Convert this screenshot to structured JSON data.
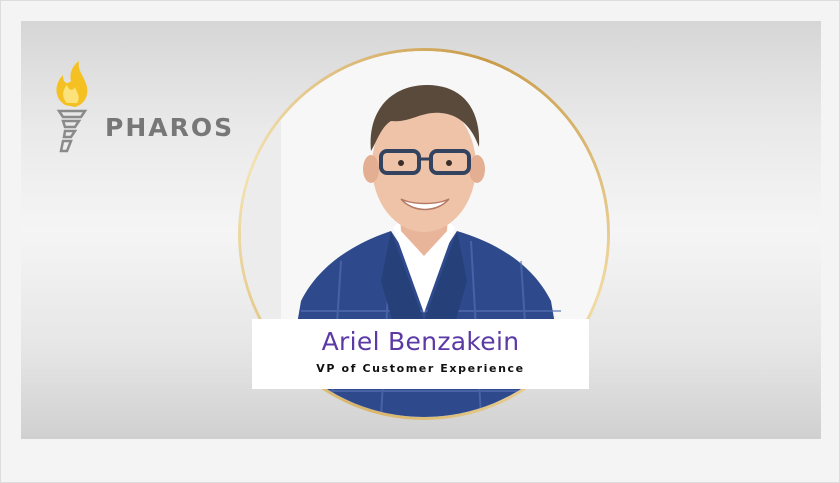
{
  "banner": {
    "logo": {
      "icon": "torch-icon",
      "text": "PHAROS",
      "colors": {
        "flame": "#f5c021",
        "torch": "#8a8a8a",
        "text": "#777777"
      }
    },
    "portrait": {
      "image": "headshot-photo",
      "ring_color": "#d8b56a"
    },
    "nameplate": {
      "name": "Ariel Benzakein",
      "title": "VP of Customer Experience",
      "name_color": "#5b3aa6"
    }
  }
}
